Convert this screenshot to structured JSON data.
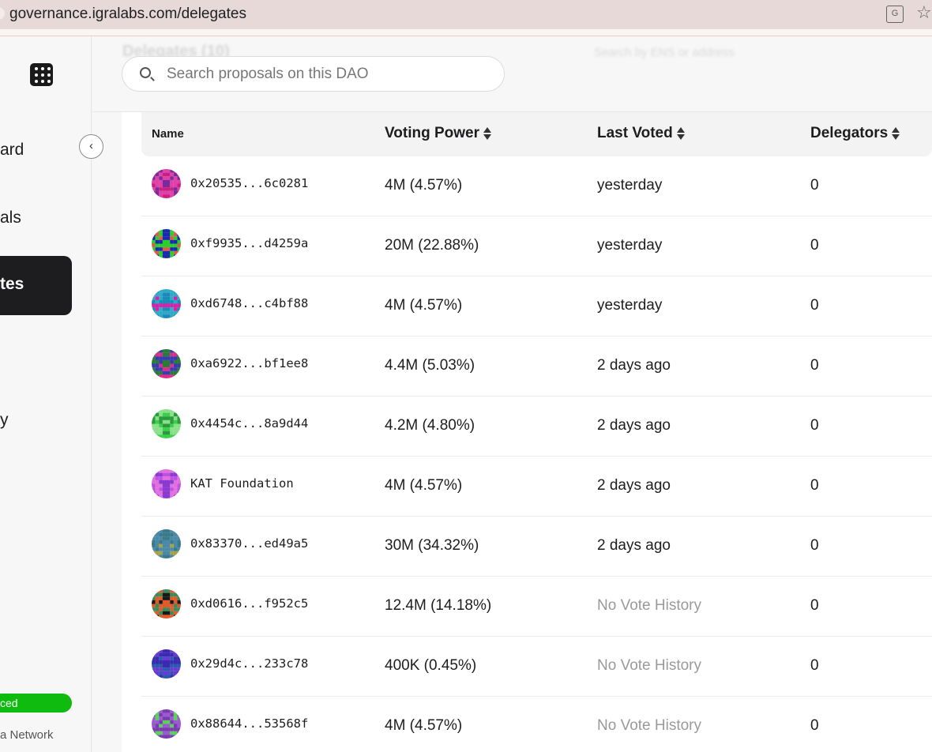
{
  "browser": {
    "url": "governance.igralabs.com/delegates",
    "translate_icon": "translate-icon",
    "bookmark_icon": "star-icon"
  },
  "sidebar": {
    "items": [
      {
        "label": "ard"
      },
      {
        "label": "als"
      },
      {
        "label": "tes",
        "active": true
      },
      {
        "label": "y"
      }
    ],
    "status": "ced",
    "network": "a Network"
  },
  "header": {
    "ghost_title": "Delegates (10)",
    "ghost_search": "Search by ENS or address",
    "search_placeholder": "Search proposals on this DAO"
  },
  "table": {
    "columns": {
      "name": "Name",
      "voting_power": "Voting Power",
      "last_voted": "Last Voted",
      "delegators": "Delegators"
    },
    "rows": [
      {
        "name": "0x20535...6c0281",
        "voting_power": "4M (4.57%)",
        "last_voted": "yesterday",
        "delegators": "0",
        "colors": [
          "#e040a8",
          "#7a2a9a",
          "#c82080"
        ]
      },
      {
        "name": "0xf9935...d4259a",
        "voting_power": "20M (22.88%)",
        "last_voted": "yesterday",
        "delegators": "0",
        "colors": [
          "#2ad02a",
          "#1a2ab0",
          "#e05a4a"
        ]
      },
      {
        "name": "0xd6748...c4bf88",
        "voting_power": "4M (4.57%)",
        "last_voted": "yesterday",
        "delegators": "0",
        "colors": [
          "#d820a8",
          "#30a8c8",
          "#1a8ab8"
        ]
      },
      {
        "name": "0xa6922...bf1ee8",
        "voting_power": "4.4M (5.03%)",
        "last_voted": "2 days ago",
        "delegators": "0",
        "colors": [
          "#2a7a3a",
          "#3a3ab0",
          "#e02a8a"
        ]
      },
      {
        "name": "0x4454c...8a9d44",
        "voting_power": "4.2M (4.80%)",
        "last_voted": "2 days ago",
        "delegators": "0",
        "colors": [
          "#3ad04a",
          "#2a9a3a",
          "#8ae08a"
        ]
      },
      {
        "name": "KAT Foundation",
        "voting_power": "4M (4.57%)",
        "last_voted": "2 days ago",
        "delegators": "0",
        "colors": [
          "#c050e0",
          "#8a3ad0",
          "#e070e0"
        ]
      },
      {
        "name": "0x83370...ed49a5",
        "voting_power": "30M (34.32%)",
        "last_voted": "2 days ago",
        "delegators": "0",
        "colors": [
          "#4a8aa8",
          "#a8a04a",
          "#3a7a8a"
        ]
      },
      {
        "name": "0xd0616...f952c5",
        "voting_power": "12.4M (14.18%)",
        "last_voted": "No Vote History",
        "delegators": "0",
        "colors": [
          "#e05a2a",
          "#1a1a1a",
          "#3a8a5a"
        ]
      },
      {
        "name": "0x29d4c...233c78",
        "voting_power": "400K (0.45%)",
        "last_voted": "No Vote History",
        "delegators": "0",
        "colors": [
          "#3a2ab0",
          "#6a3ad0",
          "#2a5ab0"
        ]
      },
      {
        "name": "0x88644...53568f",
        "voting_power": "4M (4.57%)",
        "last_voted": "No Vote History",
        "delegators": "0",
        "colors": [
          "#9a5ad0",
          "#5ad05a",
          "#7a3ab0"
        ]
      }
    ]
  }
}
